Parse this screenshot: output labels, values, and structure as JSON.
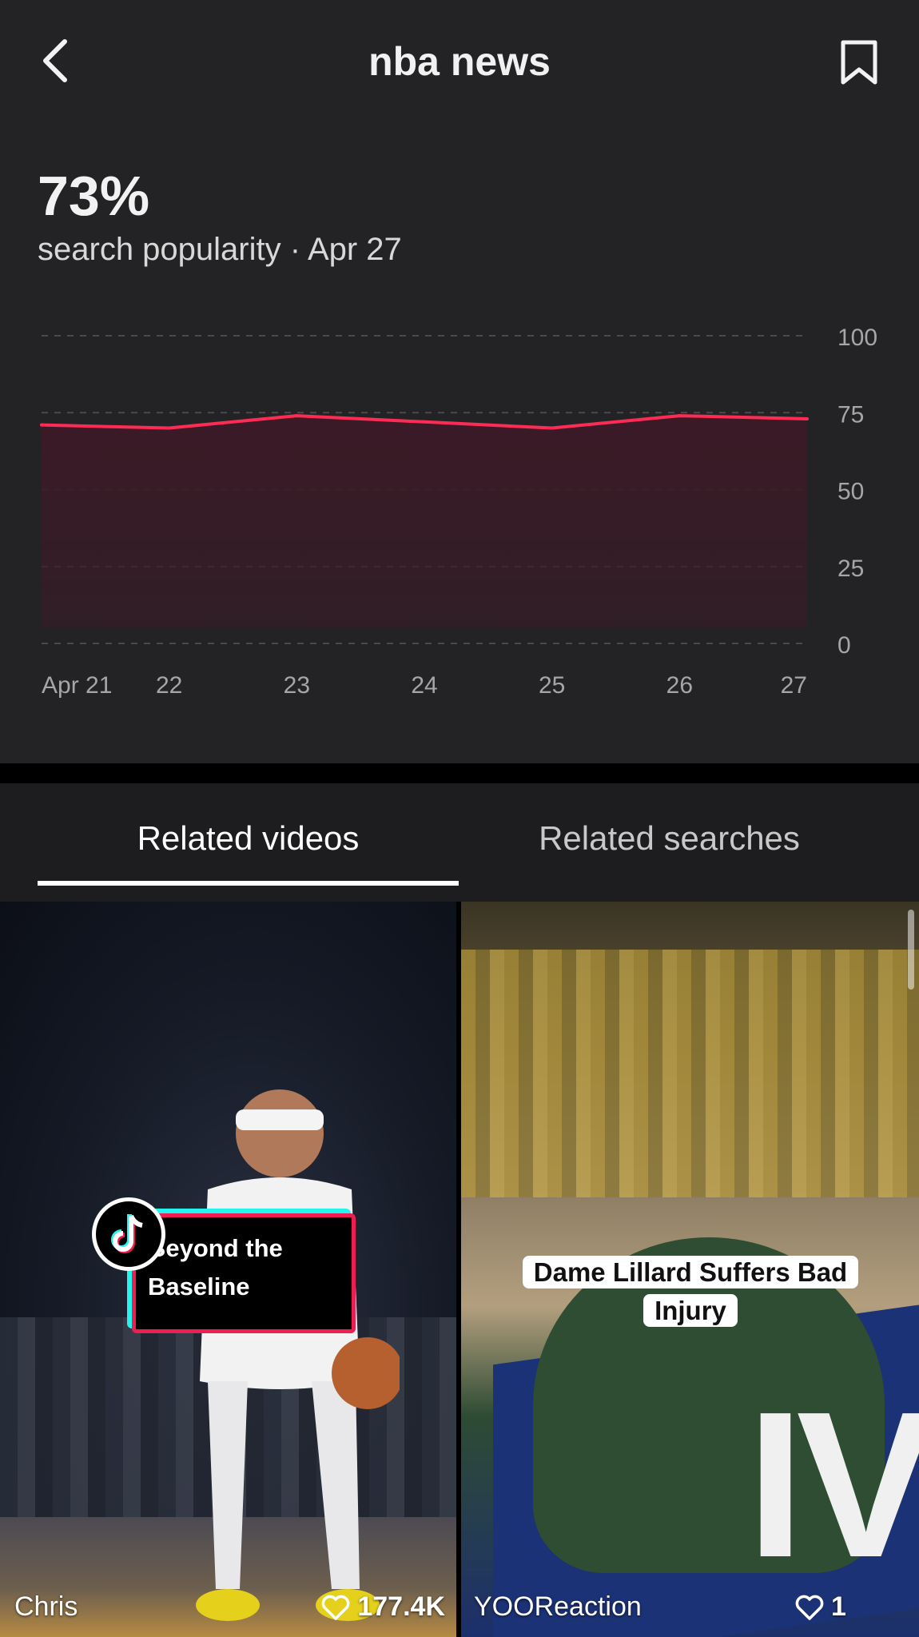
{
  "header": {
    "title": "nba news",
    "back_icon": "chevron-left-icon",
    "bookmark_icon": "bookmark-icon"
  },
  "stats": {
    "percent": "73%",
    "subtitle": "search popularity · Apr 27"
  },
  "chart_data": {
    "type": "area",
    "x": [
      "Apr 21",
      "22",
      "23",
      "24",
      "25",
      "26",
      "27"
    ],
    "values": [
      71,
      70,
      74,
      72,
      70,
      74,
      73
    ],
    "ylim": [
      0,
      100
    ],
    "y_ticks": [
      "100",
      "75",
      "50",
      "25",
      "0"
    ],
    "grid": true,
    "line_color": "#fe2c55",
    "fill_color": "#3b1a26"
  },
  "tabs": [
    {
      "label": "Related videos",
      "active": true
    },
    {
      "label": "Related searches",
      "active": false
    }
  ],
  "videos": [
    {
      "author": "Chris",
      "likes": "177.4K",
      "caption": "Beyond the Baseline"
    },
    {
      "author": "YOOReaction",
      "likes": "1",
      "caption": "Dame Lillard Suffers Bad Injury"
    }
  ],
  "colors": {
    "background": "#232325",
    "accent": "#fe2c55",
    "text": "#ffffff"
  }
}
